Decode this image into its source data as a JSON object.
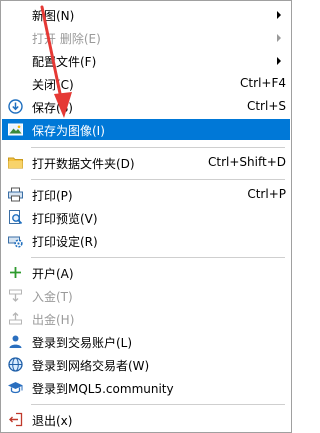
{
  "menu": {
    "items": [
      {
        "label": "新图(N)",
        "shortcut": "",
        "submenu": true,
        "icon": "",
        "disabled": false
      },
      {
        "label": "打开 删除(E)",
        "shortcut": "",
        "submenu": true,
        "icon": "",
        "disabled": true
      },
      {
        "label": "配置文件(F)",
        "shortcut": "",
        "submenu": true,
        "icon": "",
        "disabled": false
      },
      {
        "label": "关闭(C)",
        "shortcut": "Ctrl+F4",
        "submenu": false,
        "icon": "",
        "disabled": false
      },
      {
        "label": "保存(S)",
        "shortcut": "Ctrl+S",
        "submenu": false,
        "icon": "save-icon",
        "disabled": false
      },
      {
        "label": "保存为图像(I)",
        "shortcut": "",
        "submenu": false,
        "icon": "save-as-image-icon",
        "disabled": false,
        "highlighted": true
      },
      {
        "label": "打开数据文件夹(D)",
        "shortcut": "Ctrl+Shift+D",
        "submenu": false,
        "icon": "folder-icon",
        "disabled": false
      },
      {
        "label": "打印(P)",
        "shortcut": "Ctrl+P",
        "submenu": false,
        "icon": "printer-icon",
        "disabled": false
      },
      {
        "label": "打印预览(V)",
        "shortcut": "",
        "submenu": false,
        "icon": "print-preview-icon",
        "disabled": false
      },
      {
        "label": "打印设定(R)",
        "shortcut": "",
        "submenu": false,
        "icon": "print-settings-icon",
        "disabled": false
      },
      {
        "label": "开户(A)",
        "shortcut": "",
        "submenu": false,
        "icon": "plus-icon",
        "disabled": false
      },
      {
        "label": "入金(T)",
        "shortcut": "",
        "submenu": false,
        "icon": "deposit-icon",
        "disabled": true
      },
      {
        "label": "出金(H)",
        "shortcut": "",
        "submenu": false,
        "icon": "withdraw-icon",
        "disabled": true
      },
      {
        "label": "登录到交易账户(L)",
        "shortcut": "",
        "submenu": false,
        "icon": "user-icon",
        "disabled": false
      },
      {
        "label": "登录到网络交易者(W)",
        "shortcut": "",
        "submenu": false,
        "icon": "globe-icon",
        "disabled": false
      },
      {
        "label": "登录到MQL5.community",
        "shortcut": "",
        "submenu": false,
        "icon": "graduation-cap-icon",
        "disabled": false
      },
      {
        "label": "退出(x)",
        "shortcut": "",
        "submenu": false,
        "icon": "exit-icon",
        "disabled": false
      }
    ]
  },
  "colors": {
    "highlight": "#0078d7",
    "annotation_arrow": "#e53935"
  }
}
